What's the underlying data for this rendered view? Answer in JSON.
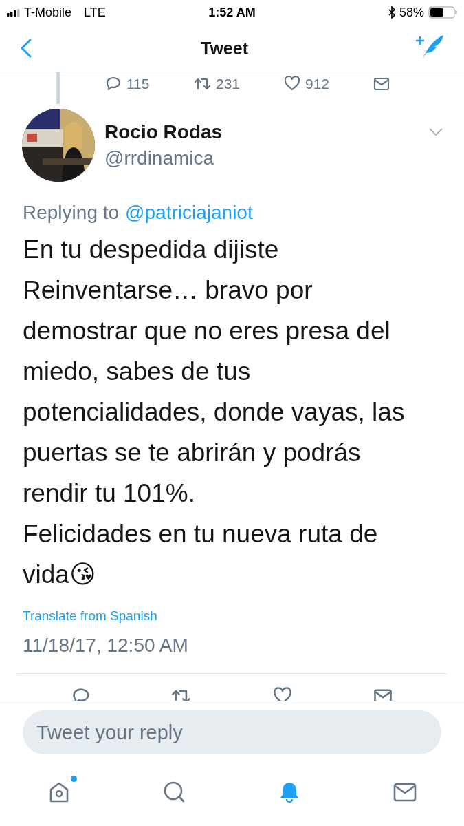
{
  "status_bar": {
    "carrier": "T-Mobile",
    "network": "LTE",
    "time": "1:52 AM",
    "battery": "58%"
  },
  "header": {
    "title": "Tweet"
  },
  "parent_tweet_stats": [
    "115",
    "231",
    "912"
  ],
  "tweet": {
    "name": "Rocio Rodas",
    "handle": "@rrdinamica",
    "replying_prefix": "Replying to",
    "replying_to": "@patriciajaniot",
    "text": "En tu despedida dijiste Reinventarse… bravo por demostrar que no eres presa del miedo, sabes de tus potencialidades, donde vayas, las puertas se te abrirán y podrás rendir tu 101%.\nFelicidades en tu nueva ruta de vida😘",
    "translate": "Translate from Spanish",
    "timestamp": "11/18/17, 12:50 AM"
  },
  "reply_field": {
    "placeholder": "Tweet your reply"
  },
  "tab_bar": [
    {
      "kind": "home",
      "selected": false,
      "dot": true
    },
    {
      "kind": "search",
      "selected": false,
      "dot": false
    },
    {
      "kind": "notifications",
      "selected": true,
      "dot": false
    },
    {
      "kind": "messages",
      "selected": false,
      "dot": false
    }
  ]
}
